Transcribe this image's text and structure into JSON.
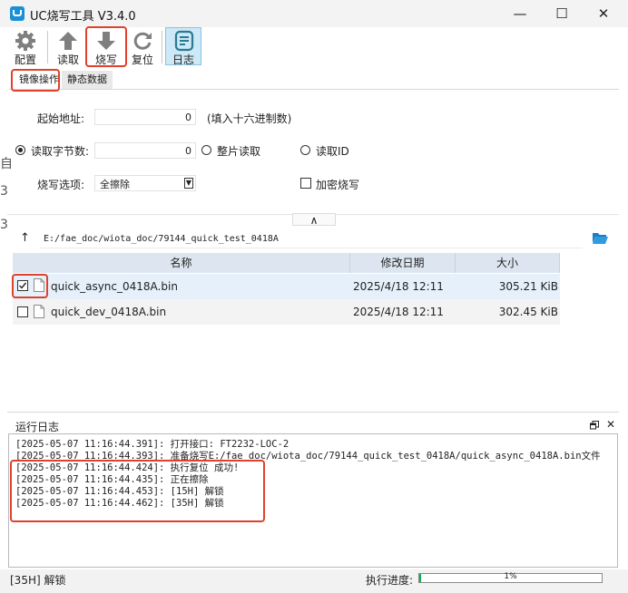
{
  "window": {
    "title": "UC烧写工具 V3.4.0",
    "minimize": "—",
    "maximize": "☐",
    "close": "✕"
  },
  "toolbar": {
    "config": "配置",
    "read": "读取",
    "burn": "烧写",
    "reset": "复位",
    "log": "日志"
  },
  "tabs": [
    {
      "label": "镜像操作"
    },
    {
      "label": "静态数据"
    }
  ],
  "form": {
    "start_addr_label": "起始地址:",
    "start_addr_value": "0",
    "start_addr_hint": "(填入十六进制数)",
    "read_bytes_label": "读取字节数:",
    "read_bytes_value": "0",
    "read_whole_label": "整片读取",
    "read_id_label": "读取ID",
    "burn_option_label": "烧写选项:",
    "burn_option_value": "全擦除",
    "encrypt_label": "加密烧写",
    "collapse_glyph": "∧"
  },
  "browser": {
    "up_glyph": "↑",
    "path": "E:/fae_doc/wiota_doc/79144_quick_test_0418A",
    "columns": [
      "名称",
      "修改日期",
      "大小"
    ],
    "files": [
      {
        "name": "quick_async_0418A.bin",
        "date": "2025/4/18 12:11",
        "size": "305.21 KiB",
        "checked": true
      },
      {
        "name": "quick_dev_0418A.bin",
        "date": "2025/4/18 12:11",
        "size": "302.45 KiB",
        "checked": false
      }
    ]
  },
  "log": {
    "title": "运行日志",
    "lines": [
      "[2025-05-07 11:16:44.391]: 打开接口: FT2232-LOC-2",
      "[2025-05-07 11:16:44.393]: 准备烧写E:/fae_doc/wiota_doc/79144_quick_test_0418A/quick_async_0418A.bin文件",
      "[2025-05-07 11:16:44.424]: 执行复位 成功!",
      "[2025-05-07 11:16:44.435]: 正在擦除",
      "[2025-05-07 11:16:44.453]: [15H] 解锁",
      "[2025-05-07 11:16:44.462]: [35H] 解锁"
    ]
  },
  "status": {
    "message": "[35H] 解锁",
    "progress_label": "执行进度:",
    "progress_text": "1%",
    "progress_value": 0.01
  },
  "background_edge": {
    "chars": [
      "自",
      "3",
      "3"
    ]
  },
  "colors": {
    "accent": "#1a8fd6",
    "highlight": "#e0412b",
    "header": "#dde6f0",
    "row_selected": "#e5f0fb"
  }
}
